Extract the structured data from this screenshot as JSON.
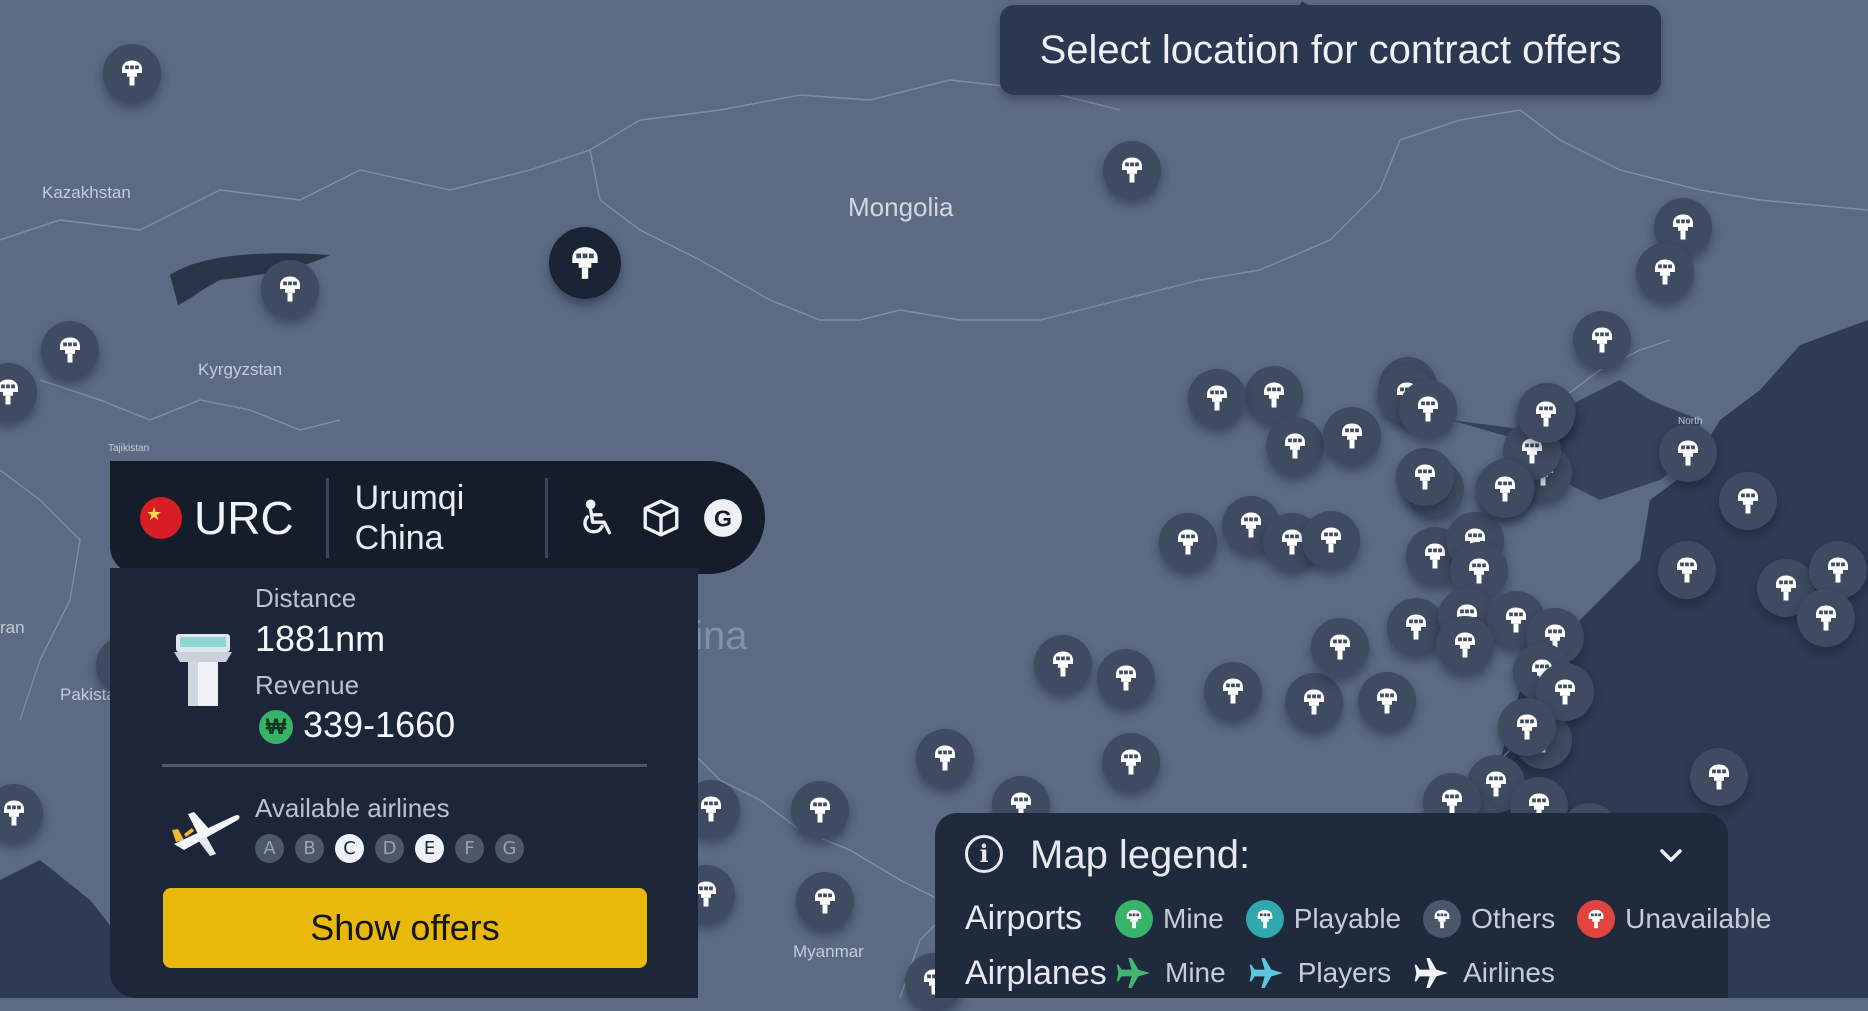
{
  "banner": {
    "text": "Select location for contract offers"
  },
  "countries": [
    {
      "name": "Kazakhstan"
    },
    {
      "name": "Mongolia"
    },
    {
      "name": "Kyrgyzstan"
    },
    {
      "name": "Tajikistan"
    },
    {
      "name": "China"
    },
    {
      "name": "ran"
    },
    {
      "name": "Pakista"
    },
    {
      "name": "Myanmar"
    },
    {
      "name": "North"
    }
  ],
  "airport": {
    "code": "URC",
    "city": "Urumqi",
    "country": "China",
    "flag_icon": "china-flag-icon",
    "features": [
      "wheelchair-icon",
      "cargo-box-icon",
      "g-class-icon"
    ]
  },
  "details": {
    "distance_label": "Distance",
    "distance_value": "1881nm",
    "revenue_label": "Revenue",
    "revenue_value": "339-1660",
    "currency_symbol": "₩",
    "airlines_label": "Available airlines",
    "classes": [
      {
        "letter": "A",
        "active": false
      },
      {
        "letter": "B",
        "active": false
      },
      {
        "letter": "C",
        "active": true
      },
      {
        "letter": "D",
        "active": false
      },
      {
        "letter": "E",
        "active": true
      },
      {
        "letter": "F",
        "active": false
      },
      {
        "letter": "G",
        "active": false
      }
    ],
    "button_label": "Show offers"
  },
  "legend": {
    "title": "Map legend:",
    "airports_label": "Airports",
    "airplanes_label": "Airplanes",
    "airports": [
      {
        "label": "Mine",
        "color": "#38b36a"
      },
      {
        "label": "Playable",
        "color": "#2fa9ad"
      },
      {
        "label": "Others",
        "color": "#4b566a"
      },
      {
        "label": "Unavailable",
        "color": "#e0443f"
      }
    ],
    "airplanes": [
      {
        "label": "Mine",
        "color": "#42b673"
      },
      {
        "label": "Players",
        "color": "#5ec6de"
      },
      {
        "label": "Airlines",
        "color": "#f2f4f7"
      }
    ]
  },
  "colors": {
    "map_land": "#5c6a84",
    "map_sea": "#2c3850",
    "accent_button": "#e8b90b"
  }
}
